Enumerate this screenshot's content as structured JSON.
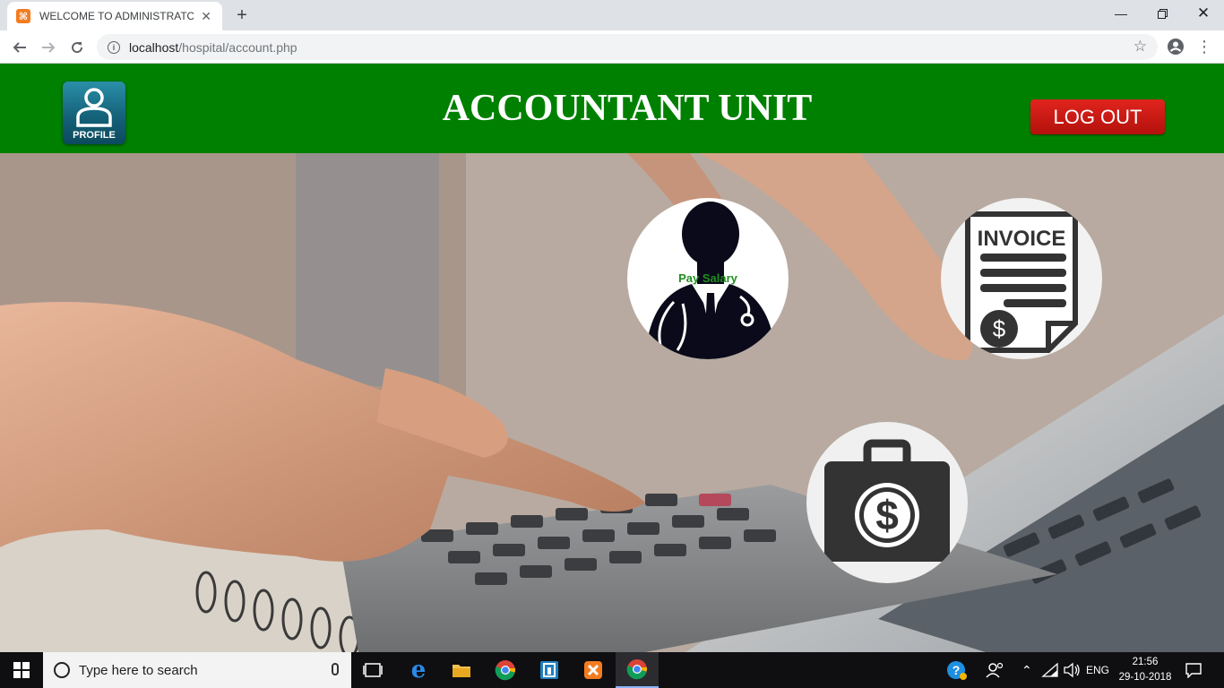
{
  "browser": {
    "tab_title": "WELCOME TO ADMINISTRATOR U",
    "favicon_letter": "⌘",
    "url_host": "localhost",
    "url_path": "/hospital/account.php"
  },
  "header": {
    "profile_label": "PROFILE",
    "title": "ACCOUNTANT UNIT",
    "logout_label": "LOG OUT"
  },
  "tiles": {
    "pay_salary_label": "Pay Salary",
    "invoice_label": "INVOICE",
    "dollar_symbol": "$"
  },
  "taskbar": {
    "search_placeholder": "Type here to search",
    "language": "ENG",
    "time": "21:56",
    "date": "29-10-2018"
  },
  "colors": {
    "header_green": "#008000",
    "logout_red": "#c4150f",
    "pay_salary_text": "#1e8f1e"
  }
}
